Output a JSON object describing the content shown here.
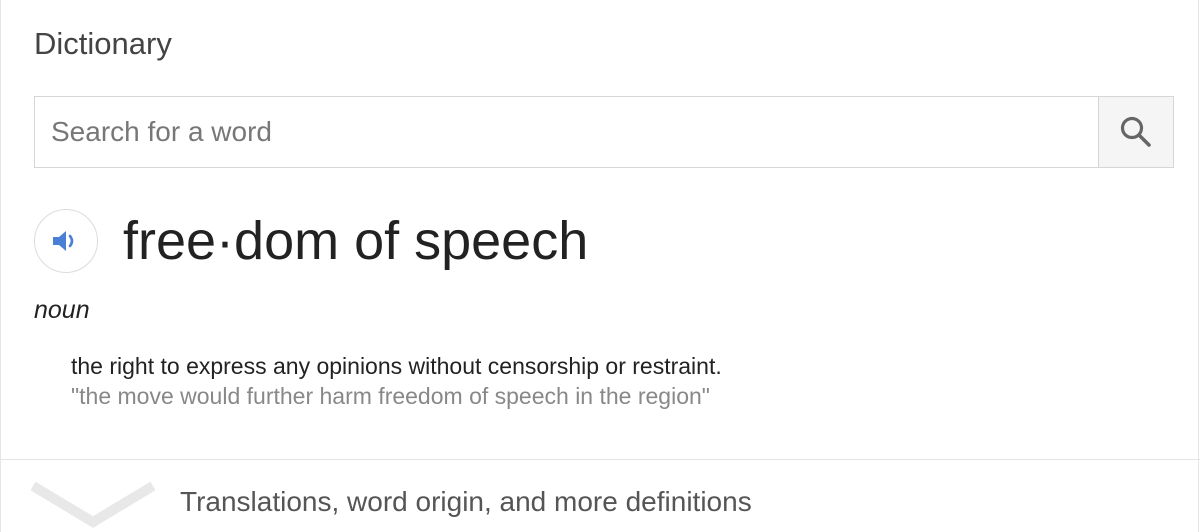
{
  "widget": {
    "title": "Dictionary"
  },
  "search": {
    "placeholder": "Search for a word",
    "value": "",
    "button_icon": "search-icon"
  },
  "entry": {
    "audio_icon": "speaker-icon",
    "headword": "free·dom of speech",
    "part_of_speech": "noun",
    "definition": "the right to express any opinions without censorship or restraint.",
    "example": "\"the move would further harm freedom of speech in the region\""
  },
  "footer": {
    "expand_icon": "chevron-down-icon",
    "more_label": "Translations, word origin, and more definitions"
  },
  "colors": {
    "accent_blue": "#4a7fd6",
    "icon_gray": "#666666",
    "chevron_gray": "#e8e8e8"
  }
}
